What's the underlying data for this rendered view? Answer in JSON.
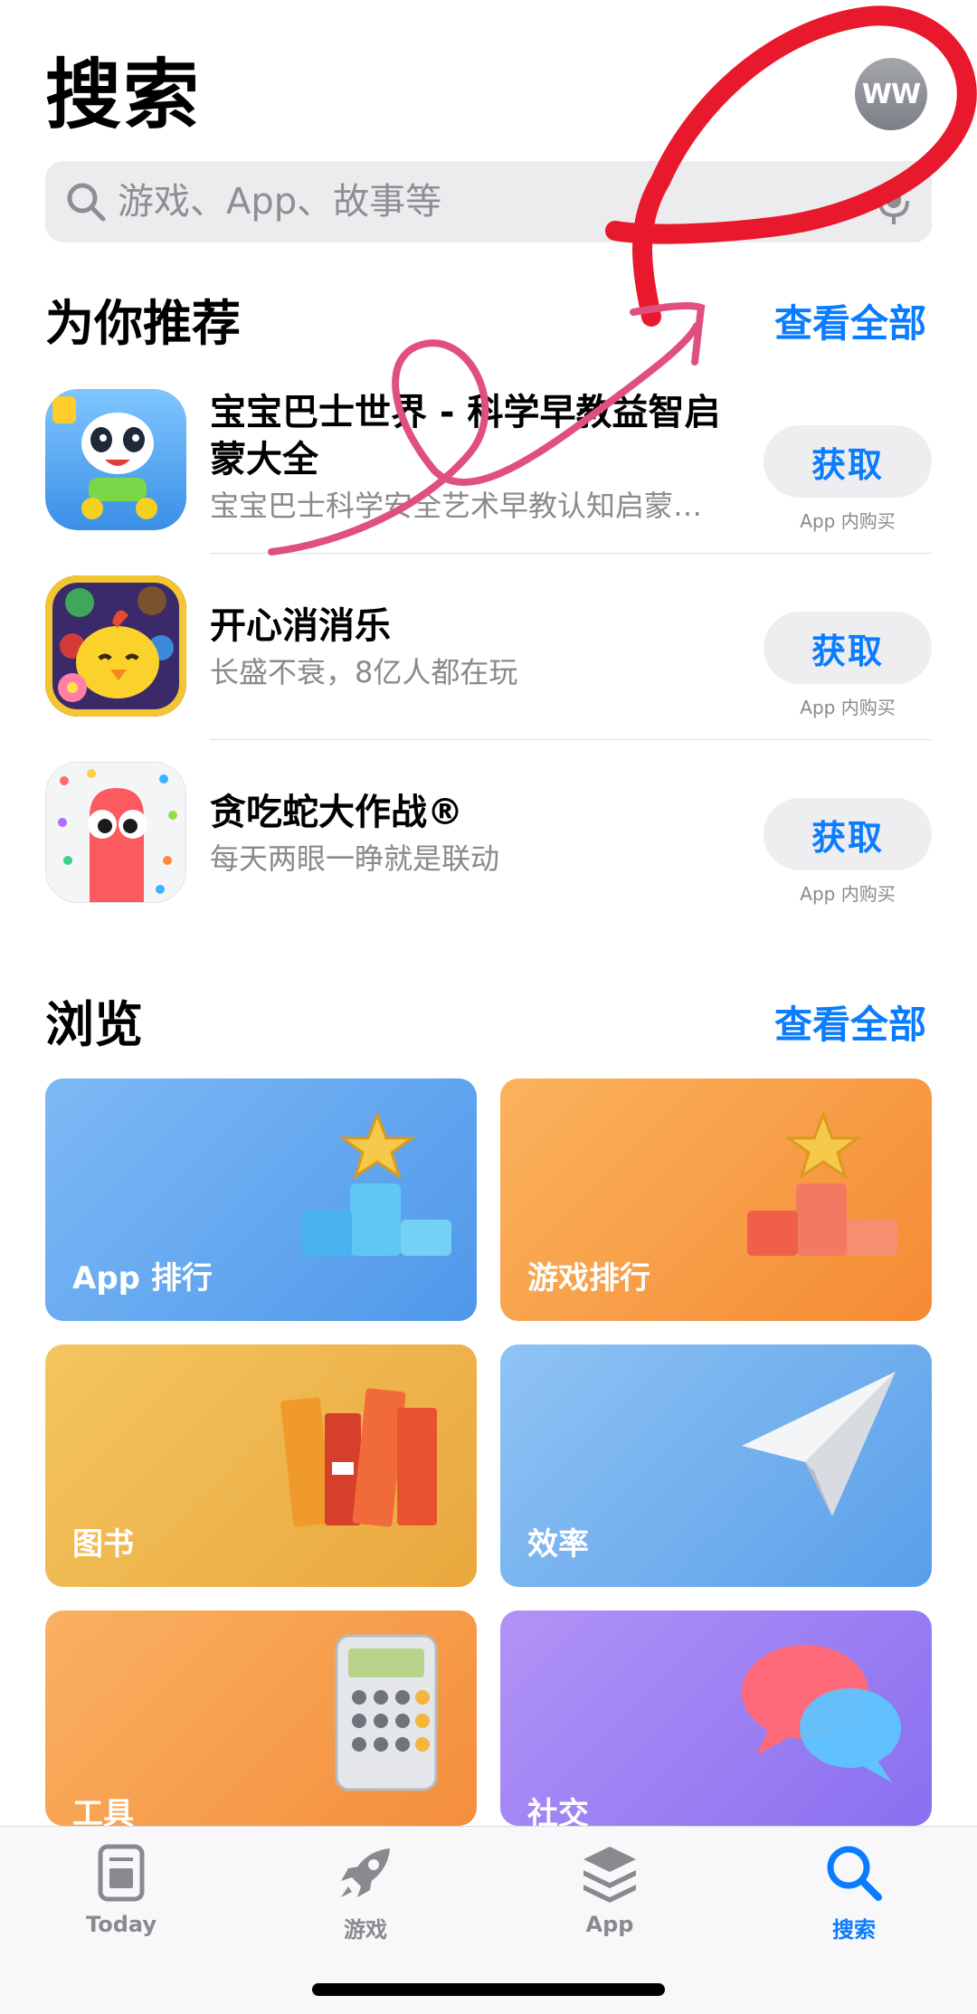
{
  "header": {
    "title": "搜索",
    "avatar_initials": "WW"
  },
  "search": {
    "placeholder": "游戏、App、故事等",
    "icon": "search-icon",
    "mic_icon": "microphone-icon"
  },
  "recommended": {
    "title": "为你推荐",
    "see_all": "查看全部",
    "apps": [
      {
        "name": "宝宝巴士世界 - 科学早教益智启蒙大全",
        "subtitle": "宝宝巴士科学安全艺术早教认知启蒙…",
        "button": "获取",
        "iap": "App 内购买"
      },
      {
        "name": "开心消消乐",
        "subtitle": "长盛不衰，8亿人都在玩",
        "button": "获取",
        "iap": "App 内购买"
      },
      {
        "name": "贪吃蛇大作战®",
        "subtitle": "每天两眼一睁就是联动",
        "button": "获取",
        "iap": "App 内购买"
      }
    ]
  },
  "browse": {
    "title": "浏览",
    "see_all": "查看全部",
    "tiles": [
      {
        "label": "App 排行",
        "color": "#5aa3ee"
      },
      {
        "label": "游戏排行",
        "color": "#f79a45"
      },
      {
        "label": "图书",
        "color": "#eeb44c"
      },
      {
        "label": "效率",
        "color": "#6daeeb"
      },
      {
        "label": "工具",
        "color": "#f6a04b"
      },
      {
        "label": "社交",
        "color": "#9a7ff0"
      }
    ]
  },
  "tabbar": {
    "tabs": [
      {
        "label": "Today",
        "icon": "today-icon"
      },
      {
        "label": "游戏",
        "icon": "rocket-icon"
      },
      {
        "label": "App",
        "icon": "layers-icon"
      },
      {
        "label": "搜索",
        "icon": "search-icon"
      }
    ],
    "active": "搜索"
  },
  "colors": {
    "accent": "#0a7cff",
    "annotation_red": "#e8192c",
    "annotation_pink": "#e0507e"
  }
}
